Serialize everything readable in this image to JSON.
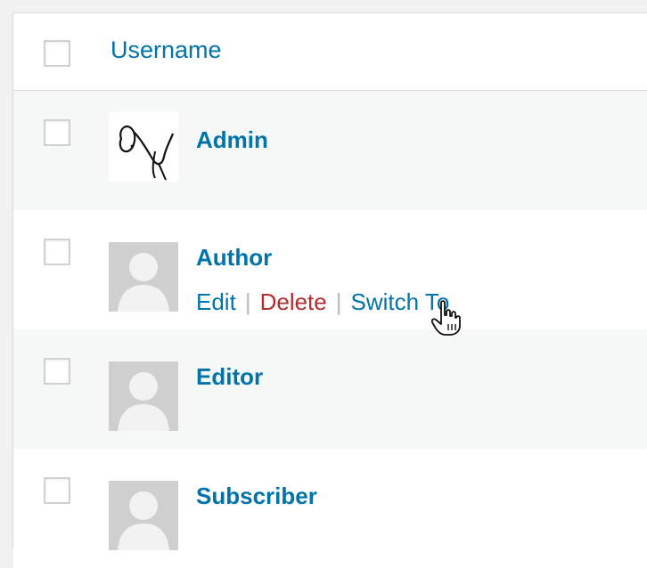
{
  "table": {
    "column_header": "Username",
    "users": [
      {
        "username": "Admin",
        "avatar": "custom-avatar-signature"
      },
      {
        "username": "Author",
        "avatar": "default-avatar",
        "actions": {
          "edit": "Edit",
          "delete": "Delete",
          "switch": "Switch To",
          "separator": "|"
        }
      },
      {
        "username": "Editor",
        "avatar": "default-avatar"
      },
      {
        "username": "Subscriber",
        "avatar": "default-avatar"
      }
    ]
  },
  "colors": {
    "link": "#0073aa",
    "delete": "#b32d2e",
    "row_alt": "#f6f7f7"
  },
  "icons": {
    "cursor": "hand-pointer-icon"
  }
}
